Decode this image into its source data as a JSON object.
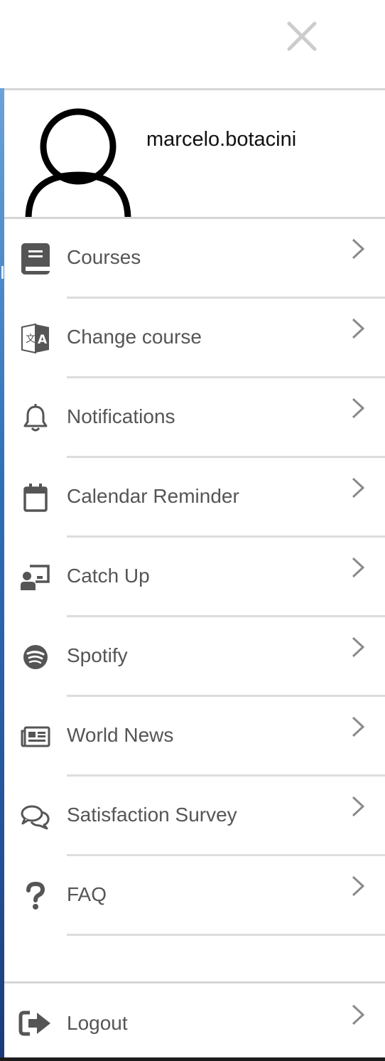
{
  "header": {
    "close_icon": "close-icon",
    "avatar_icon": "user-avatar-icon",
    "username": "marcelo.botacini"
  },
  "menu": {
    "items": [
      {
        "label": "Courses",
        "icon": "book-icon"
      },
      {
        "label": "Change course",
        "icon": "translate-icon"
      },
      {
        "label": "Notifications",
        "icon": "bell-icon"
      },
      {
        "label": "Calendar Reminder",
        "icon": "calendar-icon"
      },
      {
        "label": "Catch Up",
        "icon": "teacher-board-icon"
      },
      {
        "label": "Spotify",
        "icon": "spotify-icon"
      },
      {
        "label": "World News",
        "icon": "newspaper-icon"
      },
      {
        "label": "Satisfaction Survey",
        "icon": "comments-icon"
      },
      {
        "label": "FAQ",
        "icon": "question-icon"
      }
    ],
    "chevron_icon": "chevron-right-icon"
  },
  "footer": {
    "logout_label": "Logout",
    "logout_icon": "sign-out-icon"
  },
  "colors": {
    "text": "#555555",
    "icon": "#555555",
    "divider": "#dddddd",
    "chevron": "#8a8a8a",
    "left_accent": "#2f6fb8"
  }
}
